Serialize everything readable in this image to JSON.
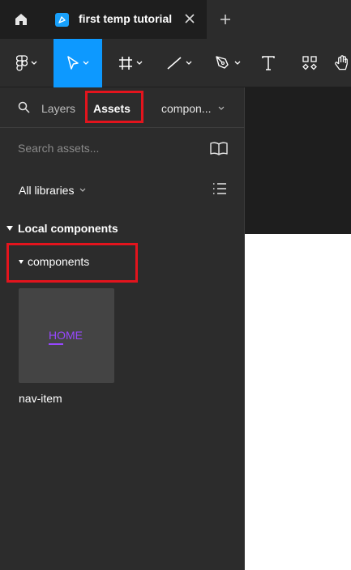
{
  "tabbar": {
    "document_title": "first temp tutorial"
  },
  "toolbar": {
    "tools": [
      "main-menu",
      "move",
      "frame",
      "line",
      "pen",
      "text",
      "components",
      "hand"
    ]
  },
  "panel": {
    "tabs": {
      "layers": "Layers",
      "assets": "Assets"
    },
    "page_selector": "compon...",
    "search": {
      "placeholder": "Search assets..."
    },
    "library_filter": "All libraries",
    "local_section": "Local components",
    "group": "components",
    "components": [
      {
        "name": "nav-item",
        "preview_text": "HOME"
      }
    ]
  },
  "colors": {
    "accent": "#0d99ff",
    "highlight": "#e3141d",
    "component_preview": "#9747ff"
  }
}
